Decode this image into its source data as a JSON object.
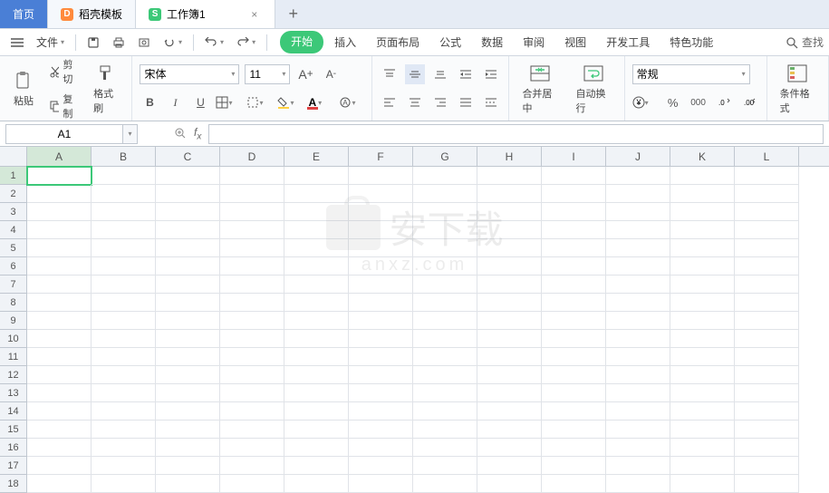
{
  "tabs": {
    "home": "首页",
    "template": "稻壳模板",
    "workbook": "工作簿1"
  },
  "menubar": {
    "file": "文件",
    "tabs": [
      "开始",
      "插入",
      "页面布局",
      "公式",
      "数据",
      "审阅",
      "视图",
      "开发工具",
      "特色功能"
    ],
    "search": "查找"
  },
  "ribbon": {
    "paste": "粘贴",
    "cut": "剪切",
    "copy": "复制",
    "format_painter": "格式刷",
    "font_name": "宋体",
    "font_size": "11",
    "merge": "合并居中",
    "wrap": "自动换行",
    "number_format": "常规",
    "cond_format": "条件格式"
  },
  "namebox": "A1",
  "columns": [
    "A",
    "B",
    "C",
    "D",
    "E",
    "F",
    "G",
    "H",
    "I",
    "J",
    "K",
    "L"
  ],
  "rows": [
    1,
    2,
    3,
    4,
    5,
    6,
    7,
    8,
    9,
    10,
    11,
    12,
    13,
    14,
    15,
    16,
    17,
    18
  ],
  "selected": {
    "col": 0,
    "row": 0
  },
  "watermark": {
    "main": "安下载",
    "sub": "anxz.com"
  }
}
